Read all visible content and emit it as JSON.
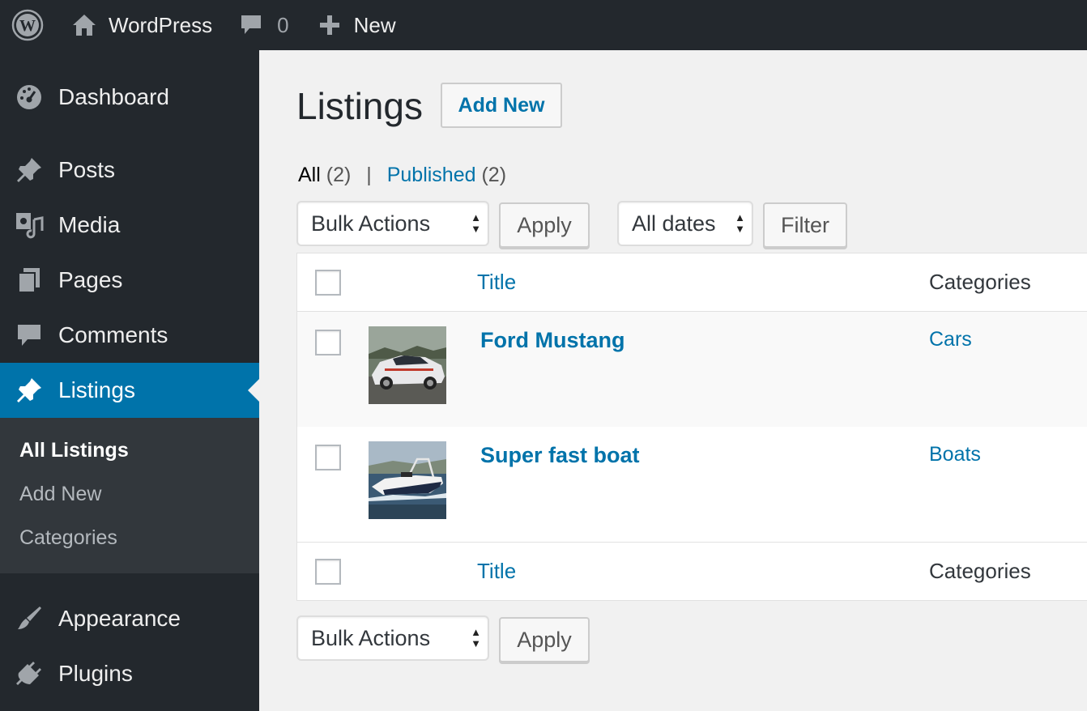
{
  "adminbar": {
    "logo_icon": "wordpress-logo-icon",
    "site_name": "WordPress",
    "site_icon": "home-icon",
    "comments_icon": "comment-bubble-icon",
    "comments_count": "0",
    "new_icon": "plus-icon",
    "new_label": "New"
  },
  "sidebar": {
    "items": [
      {
        "label": "Dashboard",
        "icon": "dashboard-icon"
      },
      {
        "label": "Posts",
        "icon": "pin-icon"
      },
      {
        "label": "Media",
        "icon": "media-icon"
      },
      {
        "label": "Pages",
        "icon": "pages-icon"
      },
      {
        "label": "Comments",
        "icon": "comment-icon"
      },
      {
        "label": "Listings",
        "icon": "pin-icon"
      },
      {
        "label": "Appearance",
        "icon": "paintbrush-icon"
      },
      {
        "label": "Plugins",
        "icon": "plug-icon"
      }
    ],
    "submenu": [
      "All Listings",
      "Add New",
      "Categories"
    ]
  },
  "page": {
    "title": "Listings",
    "add_new": "Add New"
  },
  "views": {
    "all_label": "All",
    "all_count": "(2)",
    "separator": "|",
    "published_label": "Published",
    "published_count": "(2)"
  },
  "toolbar": {
    "bulk_actions": "Bulk Actions",
    "apply": "Apply",
    "dates": "All dates",
    "filter": "Filter"
  },
  "table": {
    "columns": {
      "title": "Title",
      "categories": "Categories"
    },
    "rows": [
      {
        "title": "Ford Mustang",
        "category": "Cars"
      },
      {
        "title": "Super fast boat",
        "category": "Boats"
      }
    ]
  },
  "colors": {
    "admin_dark": "#23282d",
    "accent_blue": "#0073aa",
    "submenu_bg": "#32373c",
    "content_bg": "#f1f1f1"
  }
}
